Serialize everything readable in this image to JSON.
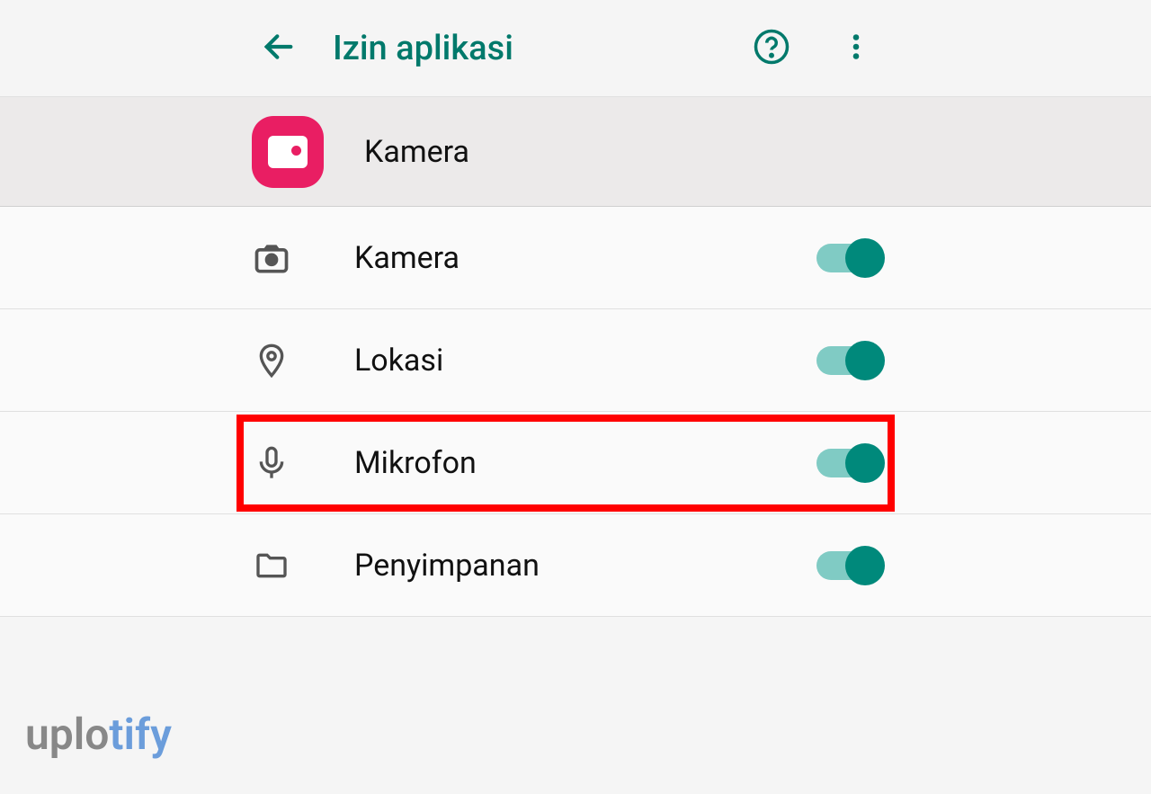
{
  "header": {
    "title": "Izin aplikasi"
  },
  "app": {
    "name": "Kamera"
  },
  "permissions": [
    {
      "label": "Kamera",
      "enabled": true
    },
    {
      "label": "Lokasi",
      "enabled": true
    },
    {
      "label": "Mikrofon",
      "enabled": true,
      "highlighted": true
    },
    {
      "label": "Penyimpanan",
      "enabled": true
    }
  ],
  "watermark": {
    "prefix": "uplo",
    "suffix": "tify"
  },
  "colors": {
    "accent": "#00796b",
    "highlight": "#ff0000",
    "toggleTrack": "#80cbc4",
    "toggleKnob": "#00897b",
    "appIconBg": "#e91e63"
  }
}
